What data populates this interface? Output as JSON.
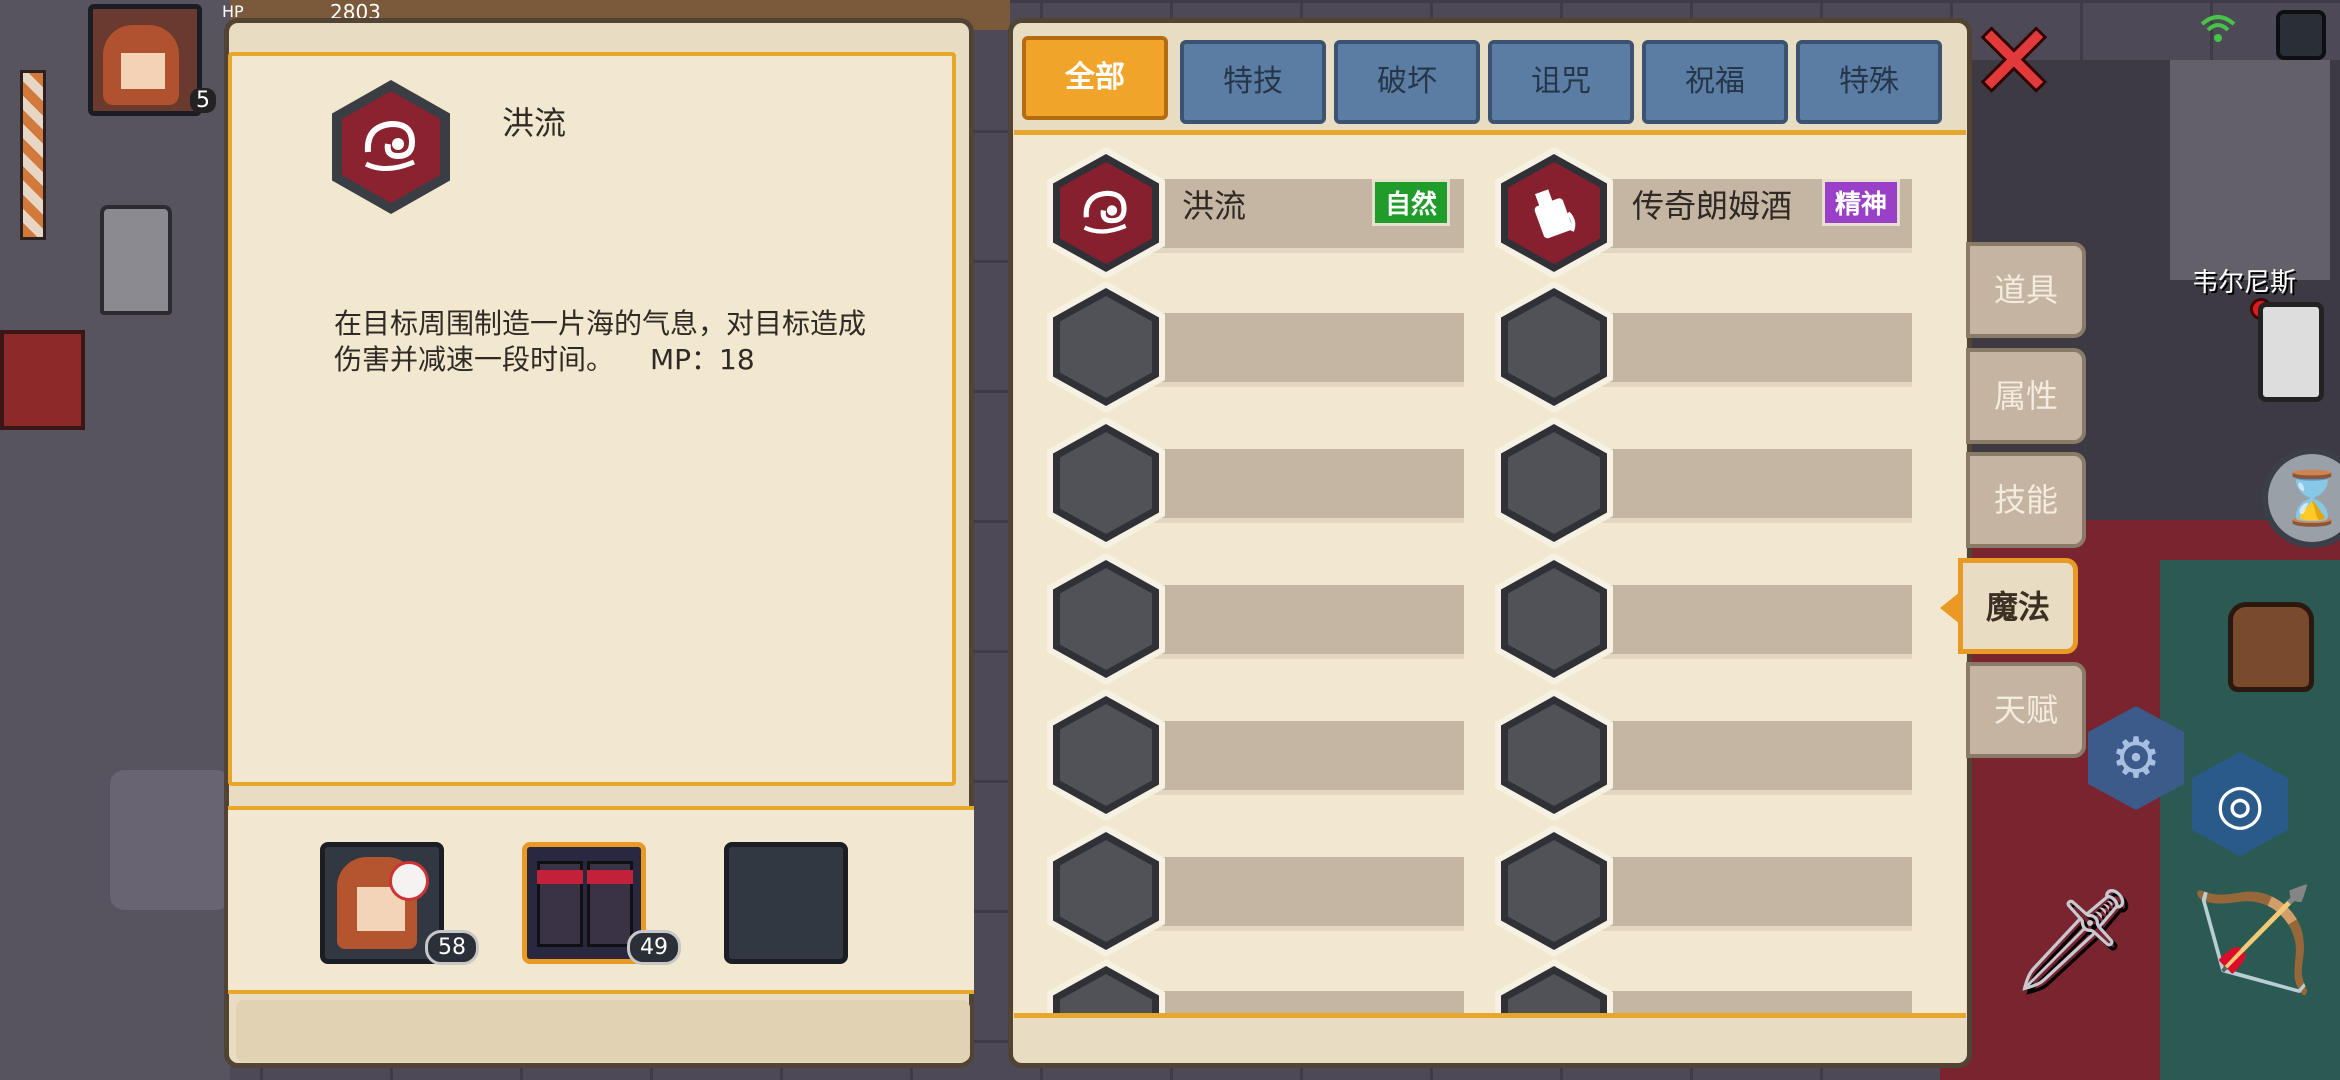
{
  "hud": {
    "hp_label": "HP",
    "hp_value": "2803",
    "portrait_level": "5",
    "npc_name": "韦尔尼斯"
  },
  "detail": {
    "skill_name": "洪流",
    "description_line1": "在目标周围制造一片海的气息，对目标造成",
    "description_line2": "伤害并减速一段时间。",
    "mp": "MP：18",
    "icon": "flood-wave-icon"
  },
  "team": [
    {
      "level": "58",
      "icon": "hero-portrait-icon",
      "selected": false
    },
    {
      "level": "49",
      "icon": "boots-portrait-icon",
      "selected": true
    },
    {
      "level": "",
      "icon": "empty-slot",
      "selected": false
    }
  ],
  "tabs": [
    {
      "label": "全部",
      "active": true
    },
    {
      "label": "特技",
      "active": false
    },
    {
      "label": "破坏",
      "active": false
    },
    {
      "label": "诅咒",
      "active": false
    },
    {
      "label": "祝福",
      "active": false
    },
    {
      "label": "特殊",
      "active": false
    }
  ],
  "skills": [
    {
      "name": "洪流",
      "tag": "自然",
      "tag_color": "#1f9c2a",
      "icon": "flood-wave-icon"
    },
    {
      "name": "传奇朗姆酒",
      "tag": "精神",
      "tag_color": "#9a3fc8",
      "icon": "rum-bottle-icon"
    }
  ],
  "side_tabs": [
    {
      "label": "道具",
      "active": false
    },
    {
      "label": "属性",
      "active": false
    },
    {
      "label": "技能",
      "active": false
    },
    {
      "label": "魔法",
      "active": true
    },
    {
      "label": "天赋",
      "active": false
    }
  ],
  "colors": {
    "accent": "#f0a42a",
    "tab_inactive": "#5c7da3",
    "panel_bg": "#f2e7cf",
    "close": "#e23a3a"
  }
}
